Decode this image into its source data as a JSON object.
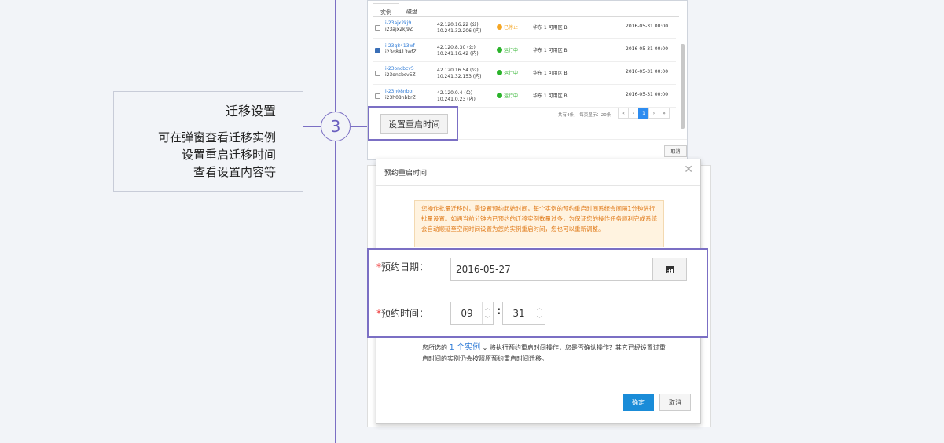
{
  "step": {
    "number": "3"
  },
  "note": {
    "title": "迁移设置",
    "lines": [
      "可在弹窗查看迁移实例",
      "设置重启迁移时间",
      "查看设置内容等"
    ]
  },
  "top_panel": {
    "tabs": [
      "实例",
      "磁盘"
    ],
    "rows": [
      {
        "checked": false,
        "id": "i-23ajx2kj9",
        "name": "i23ajx2kj9Z",
        "ip_public": "42.120.16.22 (公)",
        "ip_private": "10.241.32.206 (内)",
        "status": "已停止",
        "status_color": "#f5a623",
        "zone": "华东 1 可用区 B",
        "date": "2016-05-31 00:00"
      },
      {
        "checked": true,
        "id": "i-23q8413wf",
        "name": "i23q8413wfZ",
        "ip_public": "42.120.8.30 (公)",
        "ip_private": "10.241.16.42 (内)",
        "status": "运行中",
        "status_color": "#2bb32b",
        "zone": "华东 1 可用区 B",
        "date": "2016-05-31 00:00"
      },
      {
        "checked": false,
        "id": "i-23oncbcv5",
        "name": "i23oncbcv5Z",
        "ip_public": "42.120.16.54 (公)",
        "ip_private": "10.241.32.153 (内)",
        "status": "运行中",
        "status_color": "#2bb32b",
        "zone": "华东 1 可用区 B",
        "date": "2016-05-31 00:00"
      },
      {
        "checked": false,
        "id": "i-23h08nbbr",
        "name": "i23h08nbbrZ",
        "ip_public": "42.120.0.4 (公)",
        "ip_private": "10.241.0.23 (内)",
        "status": "运行中",
        "status_color": "#2bb32b",
        "zone": "华东 1 可用区 B",
        "date": "2016-05-31 00:00"
      }
    ],
    "page_info": "共有4条，  每页显示：20条",
    "pager": [
      "«",
      "‹",
      "1",
      "›",
      "»"
    ],
    "set_restart_button": "设置重启时间",
    "cancel": "取消"
  },
  "dialog": {
    "title": "预约重启时间",
    "close": "✕",
    "warning": "您操作批量迁移时，需设置预约起始时间，每个实例的预约重启时间系统会间隔1分钟进行批量设置。如遇当前分钟内已预约的迁移实例数量过多，为保证您的操作任务顺利完成系统会自动顺延至空闲时间设置为您的实例重启时间，您也可以重新调整。",
    "date_label": "预约日期：",
    "date_value": "2016-05-27",
    "time_label": "预约时间：",
    "hour": "09",
    "minute": "31",
    "confirm_prefix": "您所选的",
    "confirm_count": "1 个实例",
    "confirm_suffix": "将执行预约重启时间操作，您是否确认操作？其它已经设置过重启时间的实例仍会按照原预约重启时间迁移。",
    "ok": "确定",
    "cancel": "取消"
  }
}
